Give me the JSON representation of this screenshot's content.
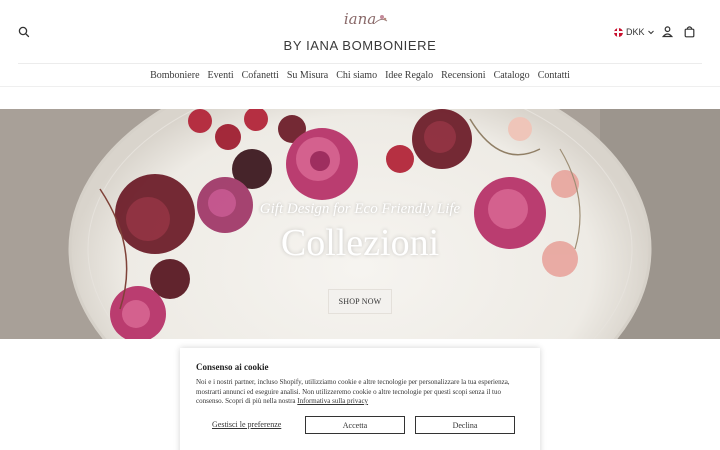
{
  "header": {
    "logo_script": "iana",
    "logo_text": "BY IANA BOMBONIERE",
    "currency": "DKK",
    "icons": {
      "search": "search-icon",
      "account": "user-icon",
      "cart": "bag-icon",
      "currency_flag": "denmark-flag-icon",
      "chevron": "chevron-down-icon"
    }
  },
  "nav": {
    "items": [
      {
        "label": "Bomboniere"
      },
      {
        "label": "Eventi"
      },
      {
        "label": "Cofanetti"
      },
      {
        "label": "Su Misura"
      },
      {
        "label": "Chi siamo"
      },
      {
        "label": "Idee Regalo"
      },
      {
        "label": "Recensioni"
      },
      {
        "label": "Catalogo"
      },
      {
        "label": "Contatti"
      }
    ]
  },
  "hero": {
    "subtitle": "Gift Design for Eco Friendly Life",
    "title": "Collezioni",
    "cta": "SHOP NOW"
  },
  "cookie": {
    "title": "Consenso ai cookie",
    "text": "Noi e i nostri partner, incluso Shopify, utilizziamo cookie e altre tecnologie per personalizzare la tua esperienza, mostrarti annunci ed eseguire analisi. Non utilizzeremo cookie o altre tecnologie per questi scopi senza il tuo consenso. Scopri di più nella nostra ",
    "link": "Informativa sulla privacy",
    "preferences": "Gestisci le preferenze",
    "accept": "Accetta",
    "decline": "Declina"
  },
  "colors": {
    "text": "#333333",
    "rose": "#b8346a",
    "burgundy": "#6e1f2b",
    "berry": "#b3263a",
    "blush": "#e8a8a0"
  }
}
